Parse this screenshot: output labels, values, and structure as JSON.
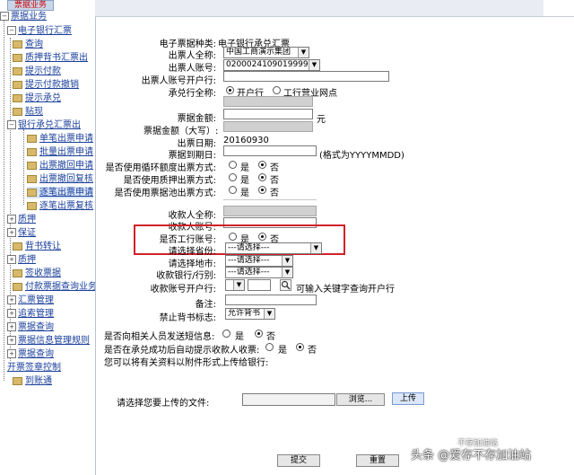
{
  "sidebar": {
    "header": "票据业务",
    "root": "票据业务",
    "items": [
      {
        "label": "电子银行汇票"
      },
      {
        "label": "查询"
      },
      {
        "label": "质押背书汇票出"
      },
      {
        "label": "提示付款"
      },
      {
        "label": "提示付款撤销"
      },
      {
        "label": "提示承兑"
      },
      {
        "label": "贴现"
      },
      {
        "label": "银行承兑汇票出"
      }
    ],
    "subitems": [
      {
        "label": "单笔出票申请"
      },
      {
        "label": "批量出票申请"
      },
      {
        "label": "出票撤回申请"
      },
      {
        "label": "出票撤回复核"
      },
      {
        "label": "逐笔出票申请"
      },
      {
        "label": "逐笔出票复核"
      }
    ],
    "items2": [
      {
        "label": "质押"
      },
      {
        "label": "保证"
      },
      {
        "label": "背书转让"
      },
      {
        "label": "质押"
      },
      {
        "label": "签收票据"
      },
      {
        "label": "付款票据查询业务"
      },
      {
        "label": "汇票管理"
      },
      {
        "label": "追索管理"
      },
      {
        "label": "票据查询"
      },
      {
        "label": "票据信息管理规则"
      },
      {
        "label": "票据查询"
      },
      {
        "label": "开票签章控制"
      },
      {
        "label": "到账通"
      }
    ]
  },
  "form": {
    "type_label": "电子票据种类:",
    "type_value": "电子银行承兑汇票",
    "drawer_name_label": "出票人全称:",
    "drawer_name_value": "中国工商演示集团",
    "drawer_acct_label": "出票人账号:",
    "drawer_acct_value": "0200024109019999888",
    "drawer_bank_label": "出票人账号开户行:",
    "acceptor_label": "承兑行全称:",
    "acceptor_opt1": "开户行",
    "acceptor_opt2": "工行营业网点",
    "amount_label": "票据金额:",
    "amount_unit": "元",
    "amount_cn_label": "票据金额（大写）:",
    "issue_date_label": "出票日期:",
    "issue_date_value": "20160930",
    "due_date_label": "票据到期日:",
    "due_date_hint": "(格式为YYYYMMDD)",
    "q1_label": "是否使用循环额度出票方式:",
    "q2_label": "是否使用质押出票方式:",
    "q3_label": "是否使用票据池出票方式:",
    "yes": "是",
    "no": "否",
    "payee_name_label": "收款人全称:",
    "payee_acct_label": "收款人账号:",
    "icbc_acct_label": "是否工行账号:",
    "province_label": "请选择省份:",
    "province_value": "---请选择---",
    "city_label": "请选择地市:",
    "city_value": "---请选择---",
    "bank_label": "收款银行/行别:",
    "bank_value": "---请选择---",
    "payee_bank_label": "收款账号开户行:",
    "payee_bank_hint": "可输入关键字查询开户行",
    "remark_label": "备注:",
    "endorse_label": "禁止背书标志:",
    "endorse_value": "允许背书",
    "sms_label": "是否向相关人员发送短信息:",
    "auto_label": "是否在承兑成功后自动提示收款人收票:",
    "attach_note": "您可以将有关资料以附件形式上传给银行:",
    "upload_label": "请选择您要上传的文件:",
    "browse": "浏览...",
    "upload": "上传",
    "submit": "提交",
    "reset": "重置"
  },
  "watermark": "头条 @爱存不存加油站",
  "watermark2": "不存加油站"
}
